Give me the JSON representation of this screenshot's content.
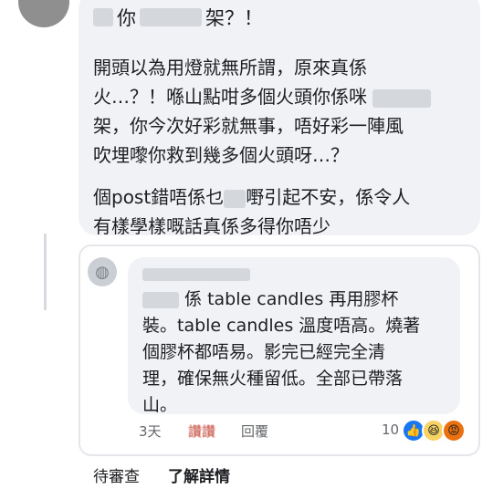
{
  "comment": {
    "title_parts": [
      "你",
      "架？！"
    ],
    "para1": [
      "開頭以為用燈就無所謂，原來真係",
      "火…？！喺山點咁多個火頭你係咪",
      "架，你今次好彩就無事，唔好彩一陣風",
      "吹埋嚟你救到幾多個火頭呀…？"
    ],
    "para2_pre": "個post錯唔係乜",
    "para2_post": "嘢引起不安，係令人",
    "para2_line2": "有樣學樣嘅話真係多得你唔少"
  },
  "reply": {
    "line1_suffix": "係 table candles 再用膠杯",
    "lines": [
      "裝。table candles 溫度唔高。燒著",
      "個膠杯都唔易。影完已經完全清",
      "理，確保無火種留低。全部已帶落",
      "山。"
    ],
    "time": "3天",
    "like": "讚讚",
    "reply_label": "回覆",
    "reaction_count": "10",
    "reactions": [
      "like-reaction",
      "haha-reaction",
      "angry-reaction"
    ]
  },
  "footer": {
    "pending": "待審查",
    "learn_more": "了解詳情"
  }
}
